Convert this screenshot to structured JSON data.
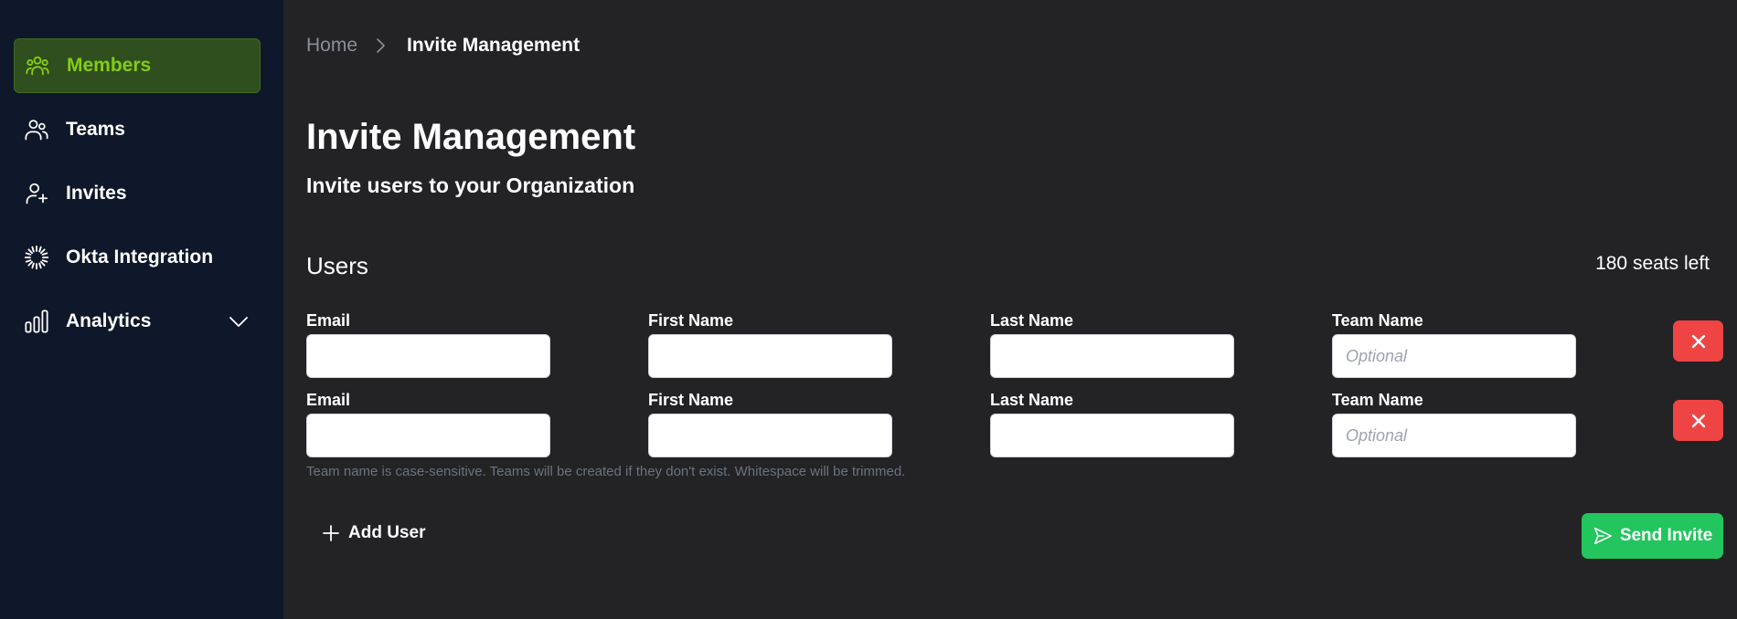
{
  "sidebar": {
    "items": [
      {
        "label": "Members",
        "icon": "users-group-icon",
        "active": true
      },
      {
        "label": "Teams",
        "icon": "team-icon",
        "active": false
      },
      {
        "label": "Invites",
        "icon": "user-plus-icon",
        "active": false
      },
      {
        "label": "Okta Integration",
        "icon": "okta-icon",
        "active": false
      },
      {
        "label": "Analytics",
        "icon": "bar-chart-icon",
        "active": false,
        "expandable": true
      }
    ]
  },
  "breadcrumb": {
    "home": "Home",
    "current": "Invite Management"
  },
  "header": {
    "title": "Invite Management",
    "subtitle": "Invite users to your Organization"
  },
  "users": {
    "section_title": "Users",
    "seats_left": "180 seats left",
    "rows": [
      {
        "email_label": "Email",
        "email_value": "",
        "first_name_label": "First Name",
        "first_name_value": "",
        "last_name_label": "Last Name",
        "last_name_value": "",
        "team_name_label": "Team Name",
        "team_name_value": "",
        "team_name_placeholder": "Optional"
      },
      {
        "email_label": "Email",
        "email_value": "",
        "first_name_label": "First Name",
        "first_name_value": "",
        "last_name_label": "Last Name",
        "last_name_value": "",
        "team_name_label": "Team Name",
        "team_name_value": "",
        "team_name_placeholder": "Optional"
      }
    ],
    "hint": "Team name is case-sensitive. Teams will be created if they don't exist. Whitespace will be trimmed."
  },
  "actions": {
    "add_user": "Add User",
    "send_invite": "Send Invite"
  },
  "colors": {
    "sidebar_bg": "#0f172a",
    "main_bg": "#232325",
    "active_accent": "#84cc16",
    "active_bg": "#2f4f1e",
    "remove_red": "#ef4444",
    "send_green": "#22c55e",
    "hint_gray": "#6b7280"
  }
}
